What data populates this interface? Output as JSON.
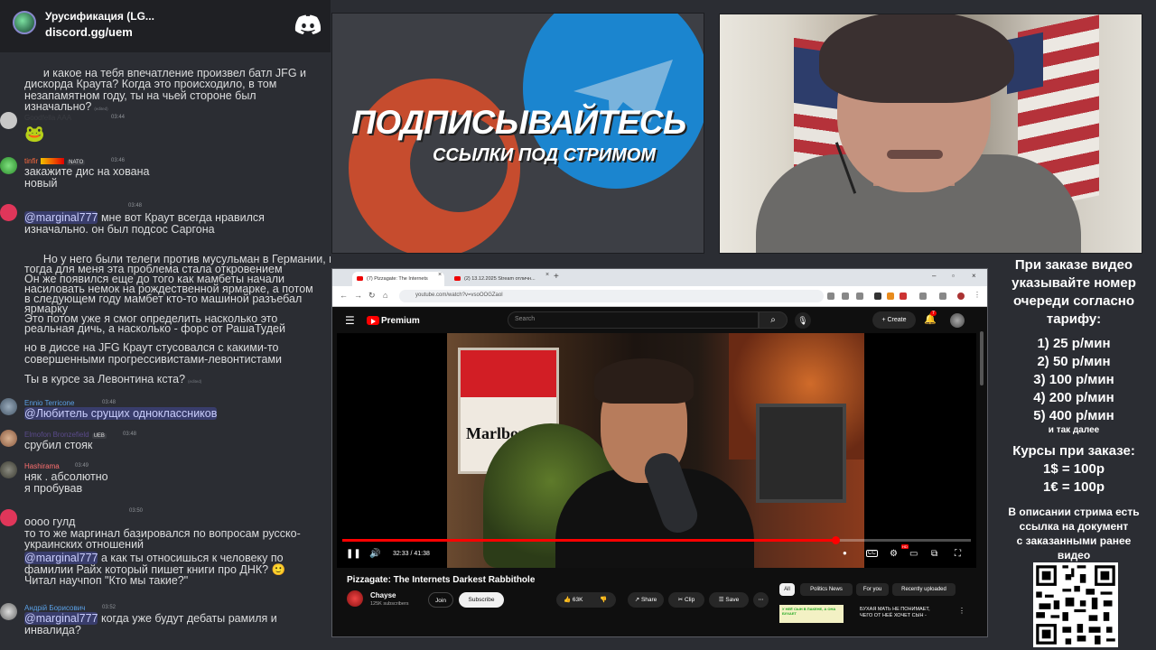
{
  "discord": {
    "server_name": "Урусификация (LG...",
    "invite": "discord.gg/uem",
    "messages": [
      {
        "text_lines": [
          "и какое на тебя впечатление произвел батл JFG и",
          "дискорда Краута? Когда это происходило, в том",
          "незапамятном году, ты на чьей стороне был",
          "изначально?"
        ],
        "edited": "(edited)"
      },
      {
        "username": "Goodfella AAA",
        "time": "03:44",
        "text": "🐸"
      },
      {
        "username": "tinfir",
        "badge": "NATO",
        "time": "03:46",
        "text_lines": [
          "закажите дис на хована",
          "новый"
        ]
      },
      {
        "time": "03:48",
        "mention": "@marginal777",
        "text_lines": [
          " мне вот Краут всегда нравился",
          "изначально. он был подсос Саргона"
        ]
      },
      {
        "text_lines": [
          "Но у него были телеги против мусульман в Германии, и",
          "тогда для меня эта проблема стала откровением",
          "Он же появился еще до того как мамбеты начали",
          "насиловать немок на рождественной ярмарке, а потом",
          "в следующем году мамбет кто-то машиной разъебал",
          "ярмарку",
          "Это потом уже я смог определить насколько это",
          "реальная дичь, а насколько - форс от РашаТудей"
        ]
      },
      {
        "text_lines": [
          "но в диссе на JFG Краут стусовался с какими-то",
          "совершенными прогрессивистами-левонтистами"
        ]
      },
      {
        "text": "Ты в курсе за Левонтина кста?",
        "edited": "(edited)"
      },
      {
        "username": "Ennio Terricone",
        "time": "03:48",
        "mention": "@Любитель срущих одноклассников"
      },
      {
        "username": "Elmofon Bronzefield",
        "badge": "UEB",
        "time": "03:48",
        "text": "срубил стояк"
      },
      {
        "username": "Hashirama",
        "time": "03:49",
        "text_lines": [
          "няк . абсолютно",
          "я пробував"
        ]
      },
      {
        "time": "03:50",
        "text_lines": [
          "оооо гулд",
          "то то же маргинал базировался по вопросам русско-",
          "украинских отношений"
        ],
        "mention": "@marginal777",
        "mention_text_lines": [
          " а как ты относишься к человеку по",
          "фамилии Райх который пишет книги про ДНК? 🙂",
          "Читал научпоп \"Кто мы такие?\""
        ]
      },
      {
        "username": "Андрій Борисович",
        "time": "03:52",
        "mention": "@marginal777",
        "text_lines": [
          " когда уже будут дебаты рамиля и",
          "инвалида?"
        ]
      }
    ]
  },
  "promo": {
    "title": "ПОДПИСЫВАЙТЕСЬ",
    "subtitle": "ССЫЛКИ ПОД СТРИМОМ"
  },
  "browser": {
    "tabs": [
      {
        "label": "(7) Pizzagate: The Internets"
      },
      {
        "label": "(2) 13.12.2025 Stream отличн..."
      }
    ],
    "url": "youtube.com/watch?v=vsoOOGZaol"
  },
  "youtube": {
    "logo_label": "Premium",
    "search_placeholder": "Search",
    "create_label": "+ Create",
    "bell_count": "7",
    "player": {
      "progress_fraction": 0.785,
      "time": "32:33 / 41:38",
      "hd_badge": "HD",
      "cc_label": "CC"
    },
    "video_title": "Pizzagate: The Internets Darkest Rabbithole",
    "channel": {
      "name": "Chayse",
      "subscribers": "125K subscribers"
    },
    "join_label": "Join",
    "subscribe_label": "Subscribe",
    "like_label": "👍  63K",
    "share_label": "↗ Share",
    "clip_label": "✂ Clip",
    "save_label": "☰ Save",
    "more_label": "⋯",
    "chips": [
      "All",
      "Politics News",
      "For you",
      "Recently uploaded"
    ],
    "rec_thumb_text": "У НЕЁ СЫН В ПАКЕНЕ, А ОНА\nБУХАЕТ",
    "rec_title": "БУХАЯ МАТЬ НЕ ПОНИМАЕТ,\nЧЕГО ОТ НЕЁ ХОЧЕТ СЫН -"
  },
  "pricing": {
    "header_lines": [
      "При заказе видео",
      "указывайте номер",
      "очереди согласно",
      "тарифу:"
    ],
    "tiers": [
      "1) 25 р/мин",
      "2) 50 р/мин",
      "3) 100 р/мин",
      "4) 200 р/мин",
      "5) 400 р/мин"
    ],
    "etc": "и так далее",
    "rates_header": "Курсы при заказе:",
    "rates": [
      "1$ = 100р",
      "1€ = 100р"
    ],
    "desc_lines": [
      "В описании стрима есть",
      "ссылка на документ",
      "с заказанными ранее",
      "видео"
    ]
  },
  "colors": {
    "discord_bg": "#2b2d33",
    "mention_bg": "#3c4270",
    "youtube_red": "#ff0000",
    "promo_blue": "#1b85cf",
    "promo_red": "#c64c2e"
  }
}
